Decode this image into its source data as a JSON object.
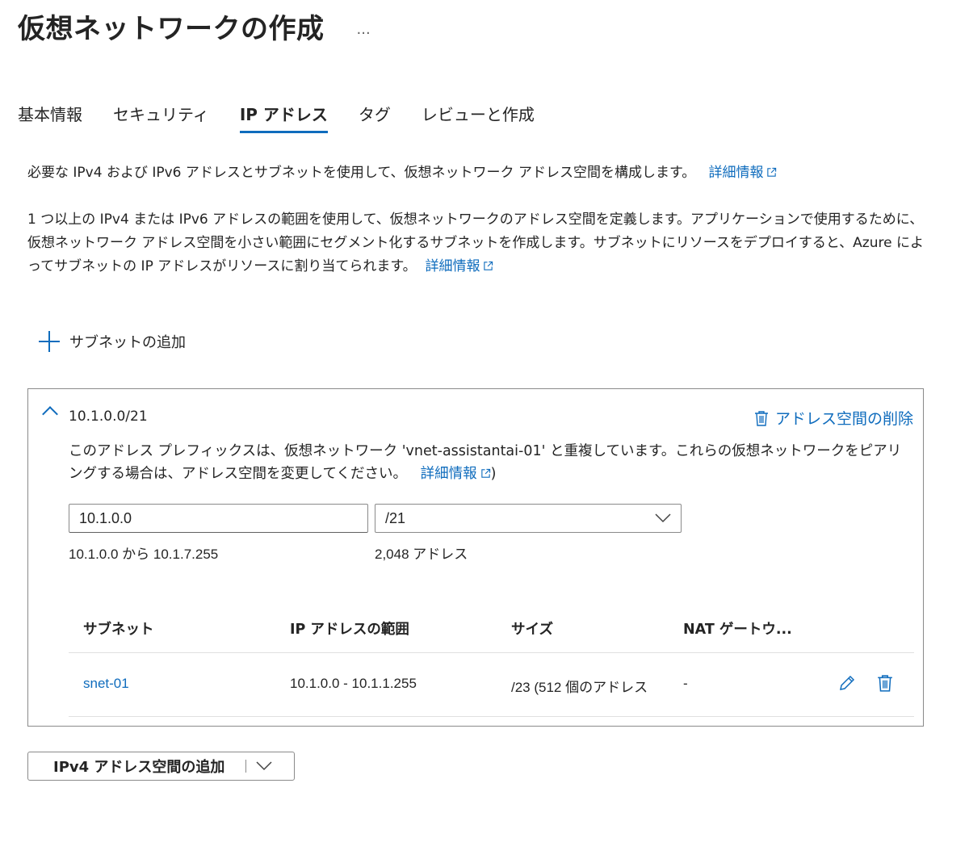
{
  "header": {
    "title": "仮想ネットワークの作成",
    "more": "···"
  },
  "tabs": [
    {
      "label": "基本情報",
      "active": false
    },
    {
      "label": "セキュリティ",
      "active": false
    },
    {
      "label": "IP アドレス",
      "active": true
    },
    {
      "label": "タグ",
      "active": false
    },
    {
      "label": "レビューと作成",
      "active": false
    }
  ],
  "description": {
    "line1": "必要な IPv4 および IPv6 アドレスとサブネットを使用して、仮想ネットワーク アドレス空間を構成します。",
    "line1_link": "詳細情報",
    "para2": "1 つ以上の IPv4 または IPv6 アドレスの範囲を使用して、仮想ネットワークのアドレス空間を定義します。アプリケーションで使用するために、仮想ネットワーク アドレス空間を小さい範囲にセグメント化するサブネットを作成します。サブネットにリソースをデプロイすると、Azure によってサブネットの IP アドレスがリソースに割り当てられます。",
    "para2_link": "詳細情報"
  },
  "add_subnet": {
    "label": "サブネットの追加"
  },
  "address_space": {
    "title": "10.1.0.0/21",
    "delete_label": "アドレス空間の削除",
    "warning": "このアドレス プレフィックスは、仮想ネットワーク 'vnet-assistantai-01' と重複しています。これらの仮想ネットワークをピアリングする場合は、アドレス空間を変更してください。",
    "warning_link": "詳細情報",
    "warning_suffix": ")",
    "ip_value": "10.1.0.0",
    "prefix_value": "/21",
    "range_text": "10.1.0.0 から 10.1.7.255",
    "count_text": "2,048 アドレス"
  },
  "subnet_table": {
    "headers": [
      "サブネット",
      "IP アドレスの範囲",
      "サイズ",
      "NAT ゲートウ..."
    ],
    "rows": [
      {
        "name": "snet-01",
        "range": "10.1.0.0 - 10.1.1.255",
        "size": "/23 (512 個のアドレス",
        "nat": "-"
      }
    ]
  },
  "add_ipv4": {
    "label": "IPv4 アドレス空間の追加"
  },
  "colors": {
    "accent": "#0f6cbd",
    "text": "#242424",
    "border": "#8a8a8a"
  }
}
